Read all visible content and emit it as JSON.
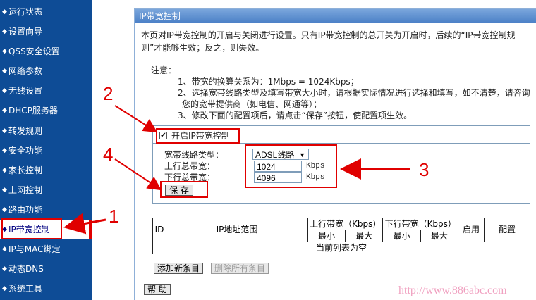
{
  "sidebar": {
    "items": [
      {
        "label": "运行状态"
      },
      {
        "label": "设置向导"
      },
      {
        "label": "QSS安全设置"
      },
      {
        "label": "网络参数"
      },
      {
        "label": "无线设置"
      },
      {
        "label": "DHCP服务器"
      },
      {
        "label": "转发规则"
      },
      {
        "label": "安全功能"
      },
      {
        "label": "家长控制"
      },
      {
        "label": "上网控制"
      },
      {
        "label": "路由功能"
      },
      {
        "label": "IP带宽控制"
      },
      {
        "label": "IP与MAC绑定"
      },
      {
        "label": "动态DNS"
      },
      {
        "label": "系统工具"
      }
    ],
    "active_index": 11
  },
  "panel": {
    "title": "IP带宽控制",
    "intro_line1": "本页对IP带宽控制的开启与关闭进行设置。只有IP带宽控制的总开关为开启时，后续的“IP带宽控制规",
    "intro_line2": "则”才能够生效；反之，则失效。",
    "note_label": "注意：",
    "note1": "1、带宽的换算关系为：1Mbps = 1024Kbps；",
    "note2a": "2、选择宽带线路类型及填写带宽大小时，请根据实际情况进行选择和填写，如不清楚，请咨询",
    "note2b": "您的宽带提供商（如电信、网通等）；",
    "note3": "3、修改下面的配置项后，请点击“保存”按钮，使配置项生效。"
  },
  "form": {
    "enable_label": "开启IP带宽控制",
    "enable_checked": true,
    "line_type_label": "宽带线路类型：",
    "line_type_value": "ADSL线路",
    "up_label": "上行总带宽：",
    "up_value": "1024",
    "down_label": "下行总带宽：",
    "down_value": "4096",
    "unit": "Kbps",
    "save_label": "保 存"
  },
  "table": {
    "col_id": "ID",
    "col_ip": "IP地址范围",
    "col_up": "上行带宽（Kbps）",
    "col_down": "下行带宽（Kbps）",
    "col_min": "最小",
    "col_max": "最大",
    "col_enable": "启用",
    "col_config": "配置",
    "empty": "当前列表为空"
  },
  "buttons": {
    "add": "添加新条目",
    "delete_all": "删除所有条目",
    "help": "帮 助"
  },
  "annotations": {
    "n1": "1",
    "n2": "2",
    "n3": "3",
    "n4": "4",
    "color": "#e00000"
  },
  "watermark": "http://www.886abc.com"
}
